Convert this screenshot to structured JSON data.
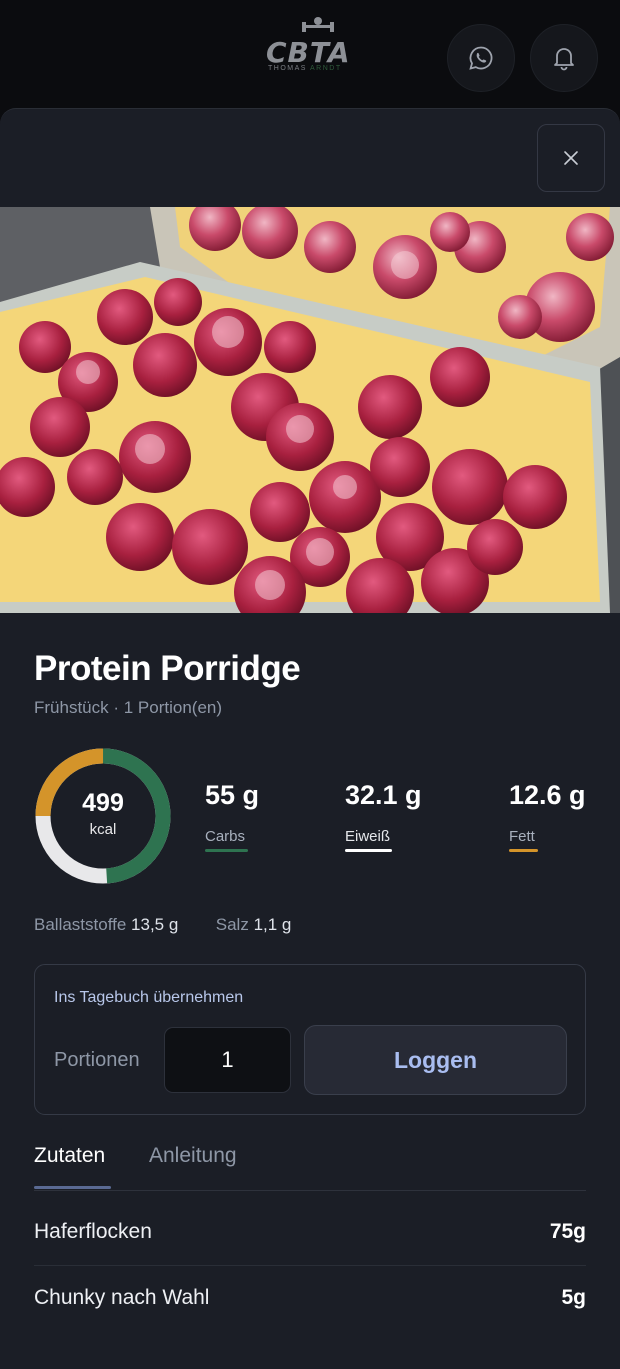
{
  "header": {
    "logo_text": "CBTA",
    "logo_sub_a": "THOMAS",
    "logo_sub_b": "ARNDT",
    "whatsapp_icon": "whatsapp-icon",
    "bell_icon": "bell-icon"
  },
  "recipe": {
    "title": "Protein Porridge",
    "subtitle": "Frühstück · 1 Portion(en)",
    "kcal_value": "499",
    "kcal_label": "kcal",
    "macros": [
      {
        "value": "55 g",
        "label": "Carbs",
        "color": "#2e7350"
      },
      {
        "value": "32.1 g",
        "label": "Eiweiß",
        "color": "#ffffff"
      },
      {
        "value": "12.6 g",
        "label": "Fett",
        "color": "#d4942a"
      }
    ],
    "donut": {
      "carbs_fraction": 0.49,
      "protein_fraction": 0.26,
      "fat_fraction": 0.25
    },
    "fiber_label": "Ballaststoffe",
    "fiber_value": "13,5 g",
    "salt_label": "Salz",
    "salt_value": "1,1 g"
  },
  "log": {
    "heading": "Ins Tagebuch übernehmen",
    "portions_label": "Portionen",
    "portions_value": "1",
    "button_label": "Loggen"
  },
  "tabs": [
    {
      "label": "Zutaten",
      "active": true
    },
    {
      "label": "Anleitung",
      "active": false
    }
  ],
  "ingredients": [
    {
      "name": "Haferflocken",
      "amount": "75g"
    },
    {
      "name": "Chunky nach Wahl",
      "amount": "5g"
    }
  ],
  "colors": {
    "background": "#0b0c0f",
    "sheet": "#1b1e26",
    "accent": "#a9bdf0",
    "carbs": "#2e7350",
    "fat": "#d4942a",
    "protein": "#ffffff"
  }
}
